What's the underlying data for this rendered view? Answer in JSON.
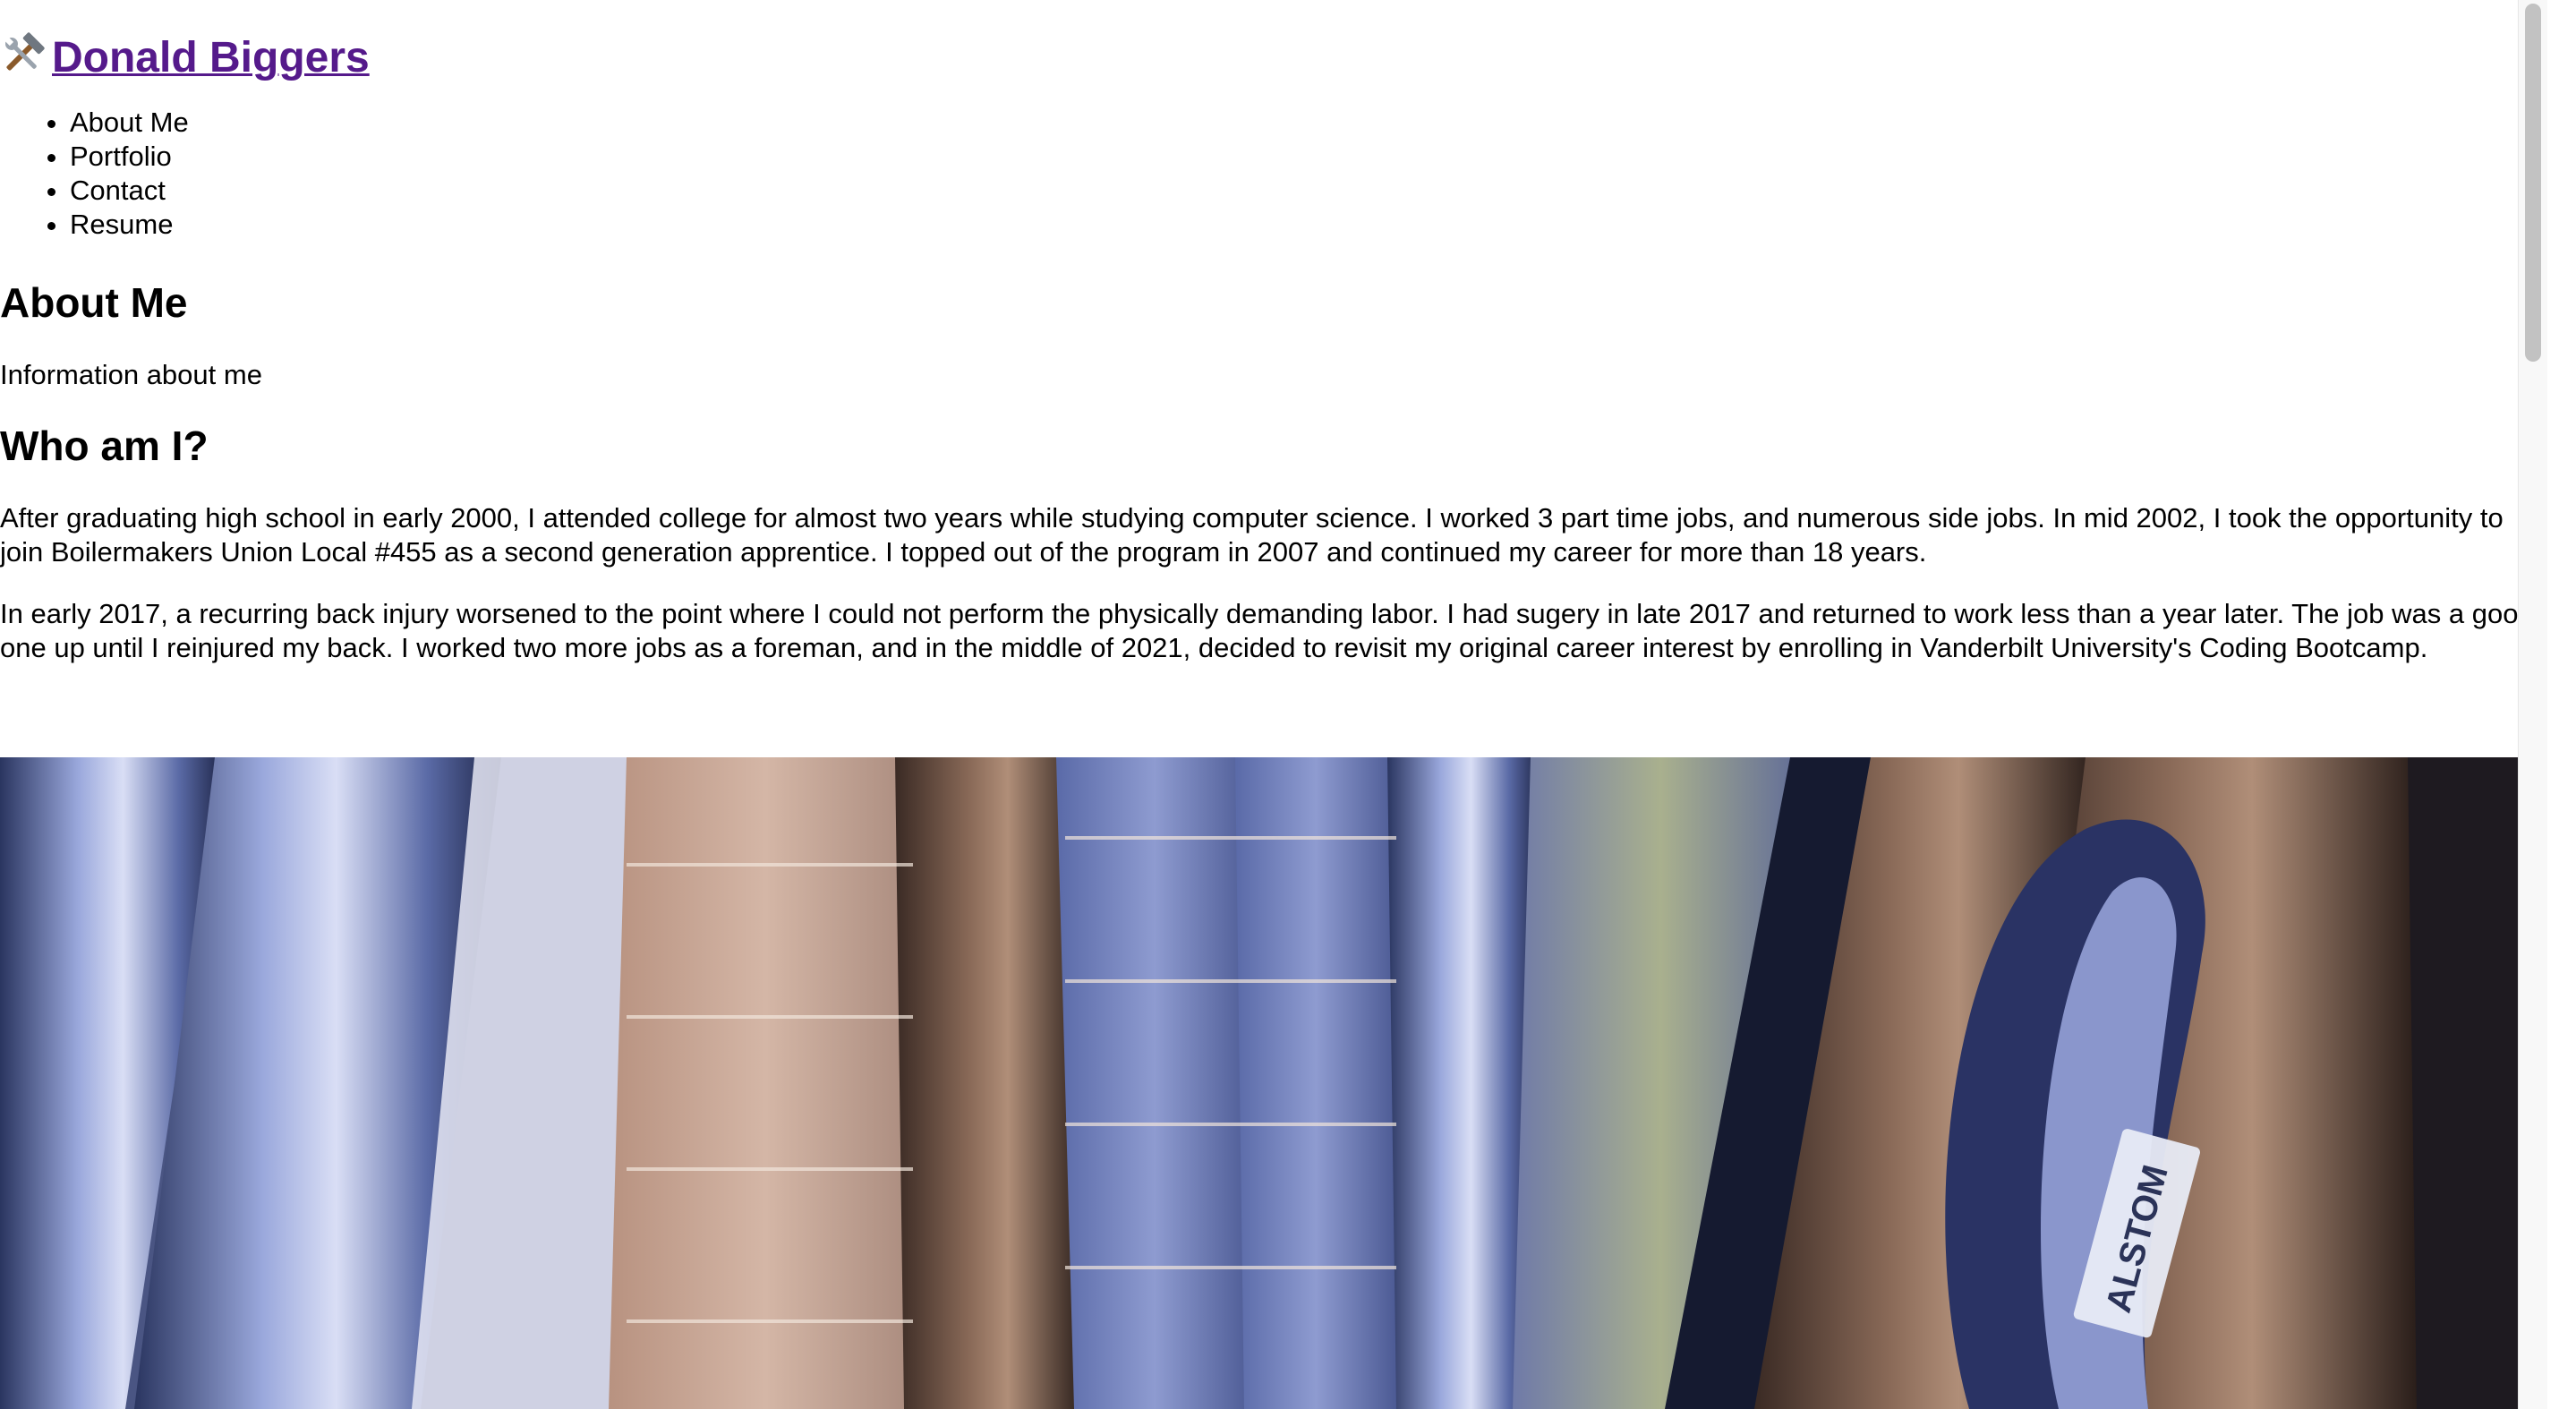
{
  "header": {
    "icon": "hammer-and-wrench-icon",
    "title": "Donald Biggers"
  },
  "nav": {
    "items": [
      {
        "label": "About Me"
      },
      {
        "label": "Portfolio"
      },
      {
        "label": "Contact"
      },
      {
        "label": "Resume"
      }
    ]
  },
  "about": {
    "heading": "About Me",
    "subtitle": "Information about me"
  },
  "who": {
    "heading": "Who am I?",
    "paragraphs": [
      "After graduating high school in early 2000, I attended college for almost two years while studying computer science. I worked 3 part time jobs, and numerous side jobs. In mid 2002, I took the opportunity to join Boilermakers Union Local #455 as a second generation apprentice. I topped out of the program in 2007 and continued my career for more than 18 years.",
      "In early 2017, a recurring back injury worsened to the point where I could not perform the physically demanding labor. I had sugery in late 2017 and returned to work less than a year later. The job was a good one up until I reinjured my back. I worked two more jobs as a foreman, and in the middle of 2021, decided to revisit my original career interest by enrolling in Vanderbilt University's Coding Bootcamp."
    ]
  },
  "photo": {
    "label_text": "ALSTOM"
  },
  "colors": {
    "link_visited": "#551a8b",
    "text": "#000000",
    "background": "#ffffff"
  }
}
